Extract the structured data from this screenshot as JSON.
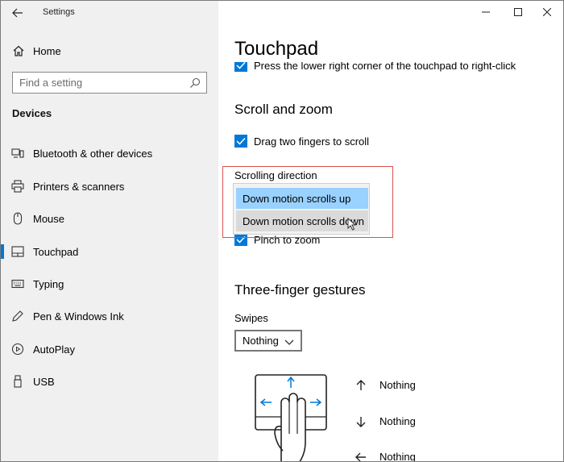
{
  "titlebar": {
    "title": "Settings",
    "back_icon": "back-arrow-icon",
    "minimize_icon": "minimize-icon",
    "maximize_icon": "maximize-icon",
    "close_icon": "close-icon"
  },
  "sidebar": {
    "home_label": "Home",
    "search_placeholder": "Find a setting",
    "section": "Devices",
    "items": [
      {
        "label": "Bluetooth & other devices",
        "icon": "bluetooth-devices-icon"
      },
      {
        "label": "Printers & scanners",
        "icon": "printer-icon"
      },
      {
        "label": "Mouse",
        "icon": "mouse-icon"
      },
      {
        "label": "Touchpad",
        "icon": "touchpad-icon",
        "active": true
      },
      {
        "label": "Typing",
        "icon": "keyboard-icon"
      },
      {
        "label": "Pen & Windows Ink",
        "icon": "pen-icon"
      },
      {
        "label": "AutoPlay",
        "icon": "autoplay-icon"
      },
      {
        "label": "USB",
        "icon": "usb-icon"
      }
    ]
  },
  "main": {
    "title": "Touchpad",
    "partial_checkbox_label": "Press the lower right corner of the touchpad to right-click",
    "scroll_heading": "Scroll and zoom",
    "drag_two_fingers_label": "Drag two fingers to scroll",
    "scroll_direction_label": "Scrolling direction",
    "scroll_direction_options": [
      "Down motion scrolls up",
      "Down motion scrolls down"
    ],
    "pinch_label": "Pinch to zoom",
    "three_finger_heading": "Three-finger gestures",
    "swipes_label": "Swipes",
    "swipes_value": "Nothing",
    "gestures": [
      {
        "icon": "arrow-up-icon",
        "label": "Nothing"
      },
      {
        "icon": "arrow-down-icon",
        "label": "Nothing"
      },
      {
        "icon": "arrow-left-icon",
        "label": "Nothing"
      }
    ]
  },
  "colors": {
    "accent": "#0078d7",
    "selected_option": "#99d1ff",
    "hover_option": "#dadada",
    "highlight_box": "#d9534f"
  }
}
